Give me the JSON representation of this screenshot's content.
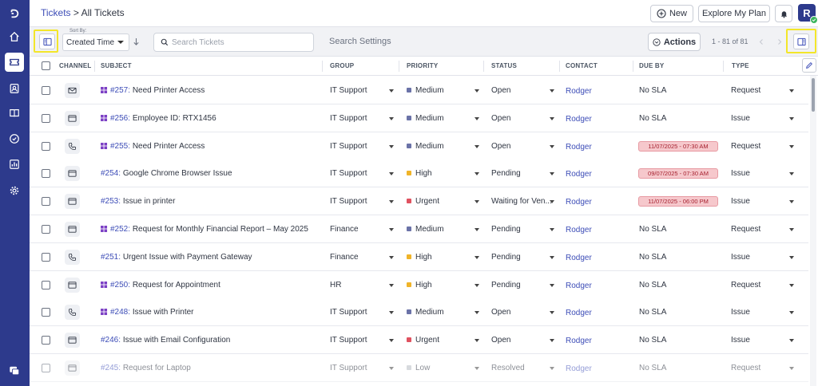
{
  "breadcrumb": {
    "link": "Tickets",
    "separator": ">",
    "current": "All Tickets"
  },
  "header": {
    "new_label": "New",
    "explore_label": "Explore My Plan",
    "avatar_initial": "R"
  },
  "toolbar": {
    "sort_caption": "Sort By:",
    "sort_value": "Created Time",
    "search_placeholder": "Search Tickets",
    "search_settings": "Search Settings",
    "actions_label": "Actions",
    "pagination": "1 - 81 of 81"
  },
  "columns": {
    "channel": "CHANNEL",
    "subject": "SUBJECT",
    "group": "GROUP",
    "priority": "PRIORITY",
    "status": "STATUS",
    "contact": "CONTACT",
    "due_by": "DUE BY",
    "type": "TYPE"
  },
  "colors": {
    "nav": "#2d3a8c",
    "link": "#3d4db7",
    "highlight": "#f3e62a",
    "priority_medium": "#6b73a8",
    "priority_high": "#f0b429",
    "priority_urgent": "#e05260",
    "priority_low": "#b8bcc4",
    "overdue_bg": "#f6c8cc"
  },
  "tickets": [
    {
      "channel": "email-icon",
      "number": "#257:",
      "title": "Need Printer Access",
      "flag": true,
      "group": "IT Support",
      "priority": "Medium",
      "status": "Open",
      "contact": "Rodger",
      "due_by": "No SLA",
      "overdue": false,
      "type": "Request"
    },
    {
      "channel": "portal-icon",
      "number": "#256:",
      "title": "Employee ID: RTX1456",
      "flag": true,
      "group": "IT Support",
      "priority": "Medium",
      "status": "Open",
      "contact": "Rodger",
      "due_by": "No SLA",
      "overdue": false,
      "type": "Issue"
    },
    {
      "channel": "phone-icon",
      "number": "#255:",
      "title": "Need Printer Access",
      "flag": true,
      "group": "IT Support",
      "priority": "Medium",
      "status": "Open",
      "contact": "Rodger",
      "due_by": "11/07/2025 - 07:30 AM",
      "overdue": true,
      "type": "Request"
    },
    {
      "channel": "portal-icon",
      "number": "#254:",
      "title": "Google Chrome Browser Issue",
      "flag": false,
      "group": "IT Support",
      "priority": "High",
      "status": "Pending",
      "contact": "Rodger",
      "due_by": "09/07/2025 - 07:30 AM",
      "overdue": true,
      "type": "Issue"
    },
    {
      "channel": "portal-icon",
      "number": "#253:",
      "title": "Issue in printer",
      "flag": false,
      "group": "IT Support",
      "priority": "Urgent",
      "status": "Waiting for Ven...",
      "contact": "Rodger",
      "due_by": "11/07/2025 - 06:00 PM",
      "overdue": true,
      "type": "Issue"
    },
    {
      "channel": "portal-icon",
      "number": "#252:",
      "title": "Request for Monthly Financial Report – May 2025",
      "flag": true,
      "group": "Finance",
      "priority": "Medium",
      "status": "Pending",
      "contact": "Rodger",
      "due_by": "No SLA",
      "overdue": false,
      "type": "Request"
    },
    {
      "channel": "phone-icon",
      "number": "#251:",
      "title": "Urgent Issue with Payment Gateway",
      "flag": false,
      "group": "Finance",
      "priority": "High",
      "status": "Pending",
      "contact": "Rodger",
      "due_by": "No SLA",
      "overdue": false,
      "type": "Issue"
    },
    {
      "channel": "portal-icon",
      "number": "#250:",
      "title": "Request for Appointment",
      "flag": true,
      "group": "HR",
      "priority": "High",
      "status": "Pending",
      "contact": "Rodger",
      "due_by": "No SLA",
      "overdue": false,
      "type": "Request"
    },
    {
      "channel": "phone-icon",
      "number": "#248:",
      "title": "Issue with Printer",
      "flag": true,
      "group": "IT Support",
      "priority": "Medium",
      "status": "Open",
      "contact": "Rodger",
      "due_by": "No SLA",
      "overdue": false,
      "type": "Issue"
    },
    {
      "channel": "portal-icon",
      "number": "#246:",
      "title": "Issue with Email Configuration",
      "flag": false,
      "group": "IT Support",
      "priority": "Urgent",
      "status": "Open",
      "contact": "Rodger",
      "due_by": "No SLA",
      "overdue": false,
      "type": "Issue"
    },
    {
      "channel": "portal-icon",
      "number": "#245:",
      "title": "Request for Laptop",
      "flag": false,
      "group": "IT Support",
      "priority": "Low",
      "status": "Resolved",
      "contact": "Rodger",
      "due_by": "No SLA",
      "overdue": false,
      "type": "Request",
      "faded": true
    }
  ]
}
